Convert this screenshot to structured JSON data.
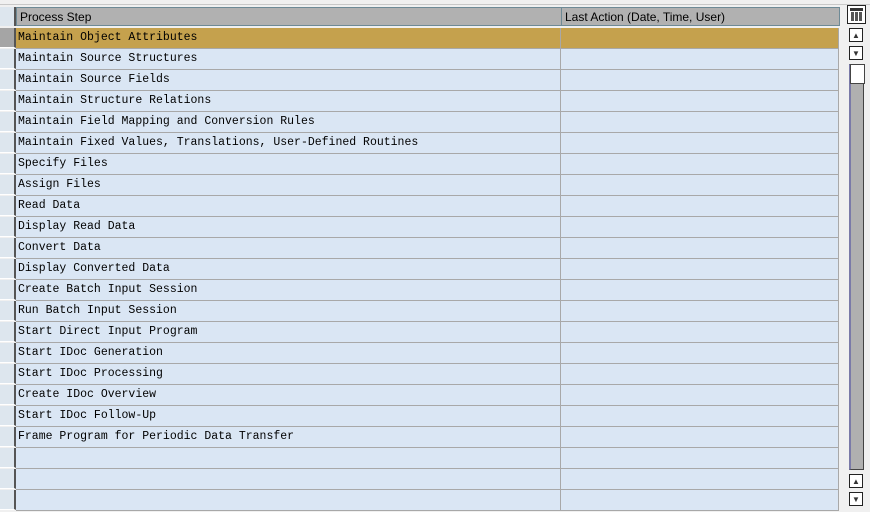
{
  "table": {
    "columns": [
      "Process Step",
      "Last Action (Date, Time, User)"
    ],
    "rows": [
      {
        "step": "Maintain Object Attributes",
        "last_action": "",
        "selected": true
      },
      {
        "step": "Maintain Source Structures",
        "last_action": ""
      },
      {
        "step": "Maintain Source Fields",
        "last_action": ""
      },
      {
        "step": "Maintain Structure Relations",
        "last_action": ""
      },
      {
        "step": "Maintain Field Mapping and Conversion Rules",
        "last_action": ""
      },
      {
        "step": "Maintain Fixed Values, Translations, User-Defined Routines",
        "last_action": ""
      },
      {
        "step": "Specify Files",
        "last_action": ""
      },
      {
        "step": "Assign Files",
        "last_action": ""
      },
      {
        "step": "Read Data",
        "last_action": ""
      },
      {
        "step": "Display Read Data",
        "last_action": ""
      },
      {
        "step": "Convert Data",
        "last_action": ""
      },
      {
        "step": "Display Converted Data",
        "last_action": ""
      },
      {
        "step": "Create Batch Input Session",
        "last_action": ""
      },
      {
        "step": "Run Batch Input Session",
        "last_action": ""
      },
      {
        "step": "Start Direct Input Program",
        "last_action": ""
      },
      {
        "step": "Start IDoc Generation",
        "last_action": ""
      },
      {
        "step": "Start IDoc Processing",
        "last_action": ""
      },
      {
        "step": "Create IDoc Overview",
        "last_action": ""
      },
      {
        "step": "Start IDoc Follow-Up",
        "last_action": ""
      },
      {
        "step": "Frame Program for Periodic Data Transfer",
        "last_action": ""
      },
      {
        "step": "",
        "last_action": ""
      },
      {
        "step": "",
        "last_action": ""
      },
      {
        "step": "",
        "last_action": ""
      }
    ]
  },
  "colors": {
    "selected_row": "#c5a14d",
    "row_bg": "#dae6f4",
    "header_bg": "#b1b1b1"
  },
  "scroll": {
    "position_fraction": 0
  }
}
